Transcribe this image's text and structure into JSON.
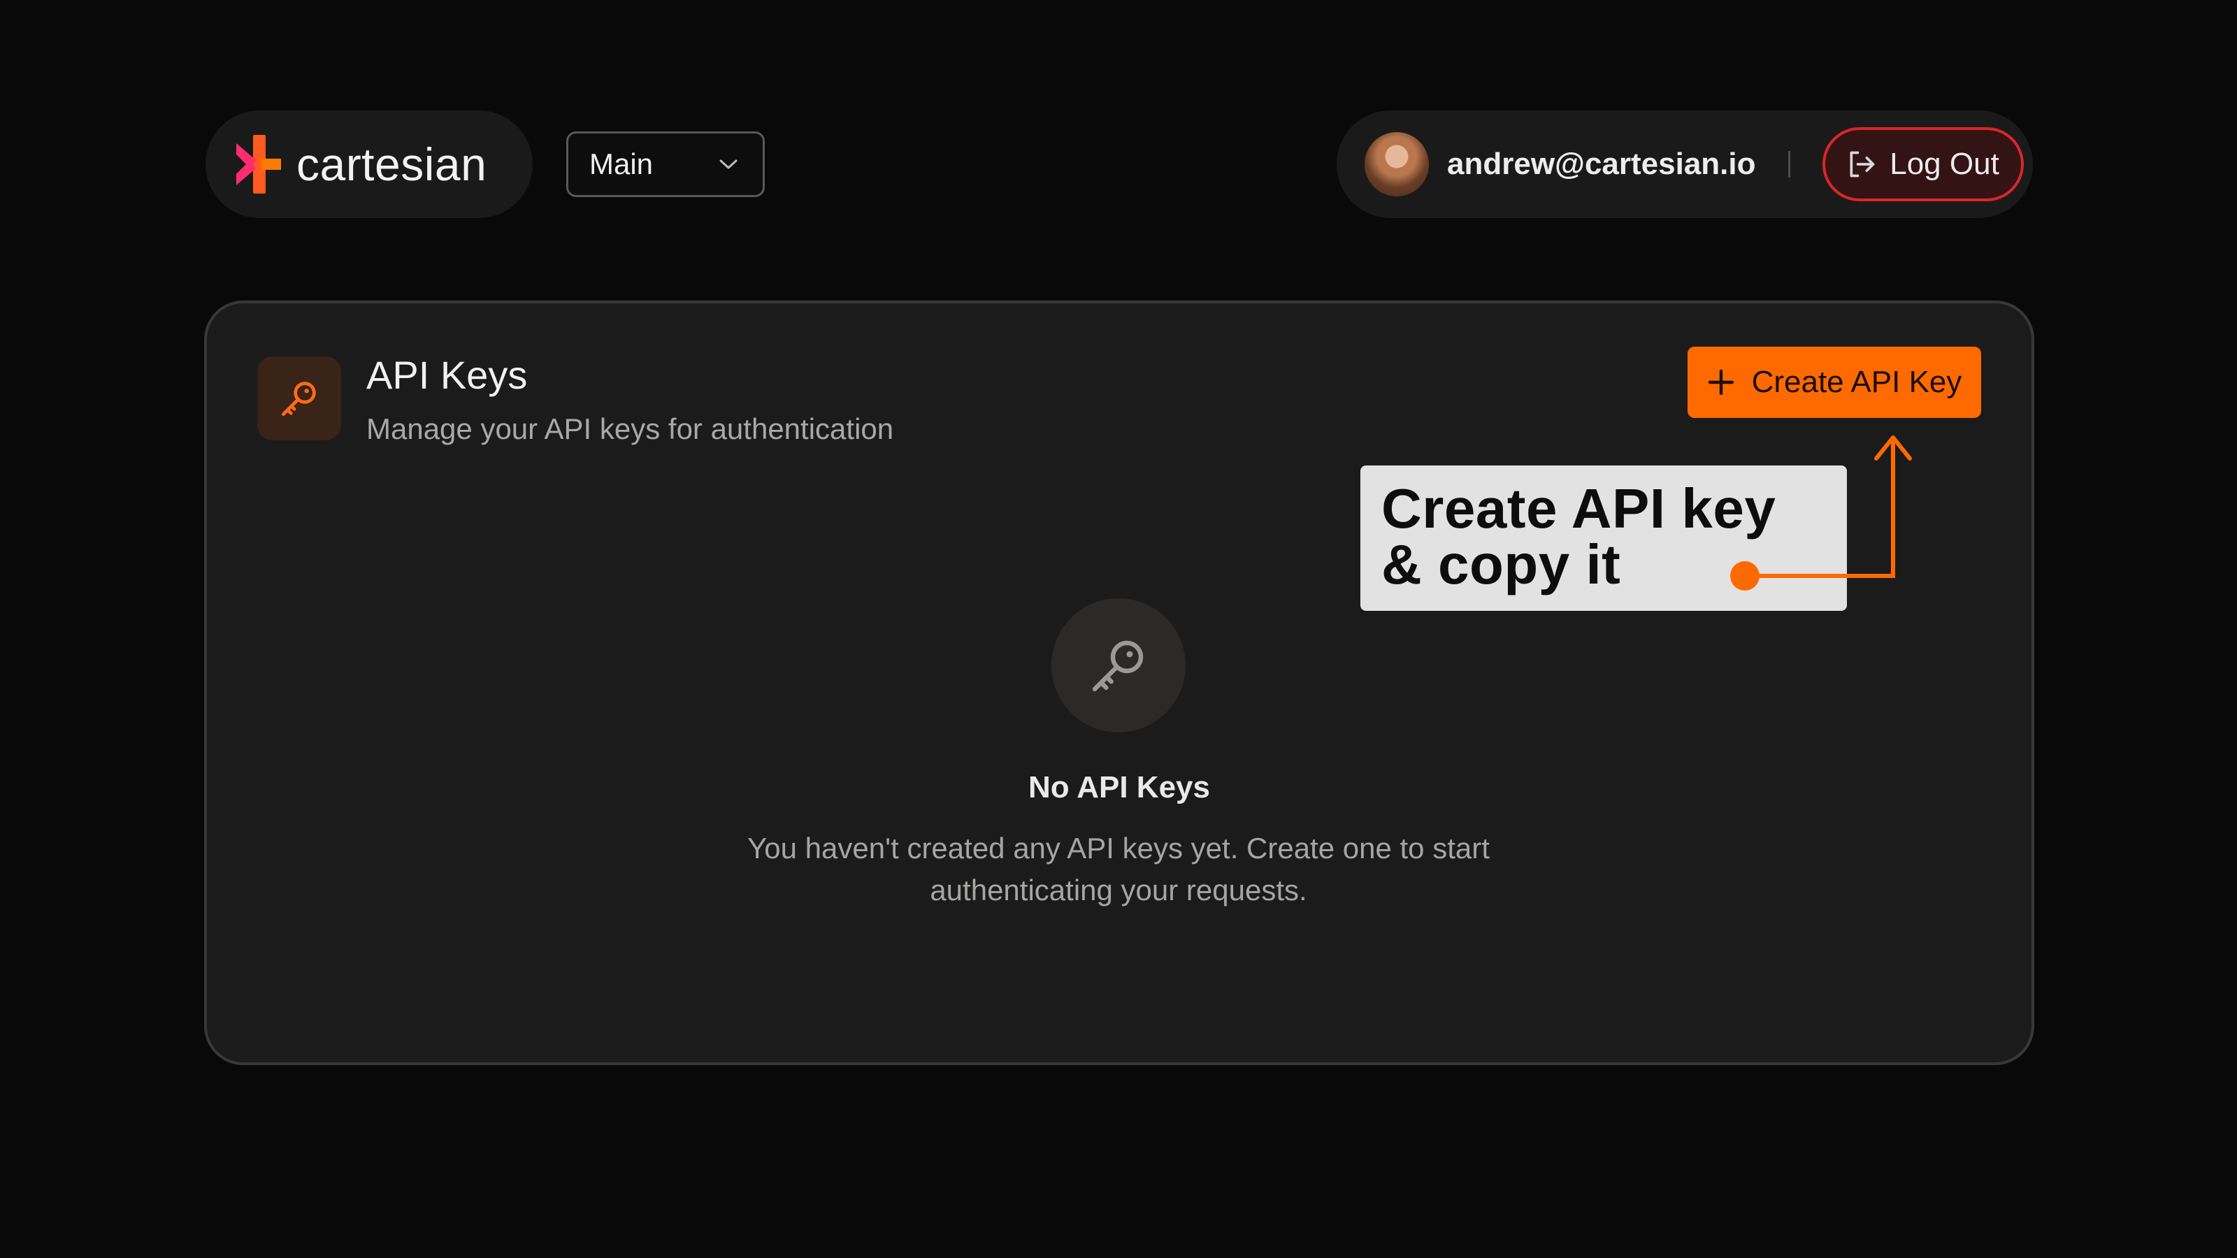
{
  "brand": {
    "name": "cartesian",
    "logo_icon": "cartesian-logo-mark"
  },
  "org_selector": {
    "selected": "Main",
    "icon": "chevron-down-icon"
  },
  "user": {
    "email": "andrew@cartesian.io",
    "avatar_icon": "user-avatar",
    "logout_label": "Log Out",
    "logout_icon": "logout-icon"
  },
  "api_keys": {
    "title": "API Keys",
    "subtitle": "Manage your API keys for authentication",
    "icon": "key-icon",
    "create_button_label": "Create API Key",
    "create_button_icon": "plus-icon",
    "empty_state": {
      "icon": "key-icon",
      "title": "No API Keys",
      "description": "You haven't created any API keys yet. Create one to start authenticating your requests."
    }
  },
  "annotation": {
    "text": "Create API key\n& copy it"
  },
  "colors": {
    "accent": "#ff6a00",
    "logout_border": "#d9262b",
    "background": "#0a0909",
    "card": "#1c1b1b"
  }
}
